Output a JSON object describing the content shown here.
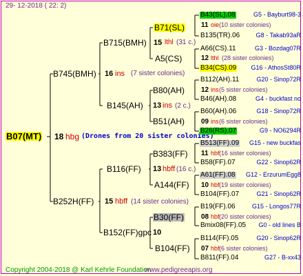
{
  "date": "29-  12-2018  (  22:   2)",
  "root": {
    "label": "B07(MT)",
    "num": "18",
    "tag": "hbg",
    "note": "(Drones from 20 sister colonies)"
  },
  "g1": [
    {
      "label": "B745(BMH)",
      "num": "16",
      "tag": "ins",
      "note": "(7 sister colonies)"
    },
    {
      "label": "B252H(FF)",
      "num": "15",
      "tag": "hbff",
      "note": "(14 sister colonies)"
    }
  ],
  "g2": [
    {
      "label": "B715(BMH)",
      "num": "",
      "tag": "",
      "note": ""
    },
    {
      "label": "B145(AH)",
      "num": "13",
      "tag": "ins",
      "note": "(2 c.)"
    },
    {
      "label": "B116(FF)",
      "num": "13",
      "tag": "hbff",
      "note": "(16 c.)"
    },
    {
      "label": "B152(FF)gpc",
      "num": "10",
      "tag": "",
      "note": ""
    }
  ],
  "g3": [
    {
      "label": "B71(SL)",
      "num": "15",
      "tag": "lthl",
      "note": "(31 c.)"
    },
    {
      "label": "A5(CS)",
      "num": "",
      "tag": "",
      "note": ""
    },
    {
      "label": "B80(AH)",
      "num": "",
      "tag": "",
      "note": ""
    },
    {
      "label": "B51(AH)",
      "num": "",
      "tag": "",
      "note": ""
    },
    {
      "label": "B383(FF)",
      "num": "",
      "tag": "",
      "note": ""
    },
    {
      "label": "A144(FF)",
      "num": "",
      "tag": "",
      "note": ""
    },
    {
      "label": "B30(FF)",
      "num": "",
      "tag": "",
      "note": ""
    },
    {
      "label": "B104(FF)",
      "num": "",
      "tag": "",
      "note": ""
    }
  ],
  "g4": [
    {
      "label": "B43(SL).08",
      "ref": "G5 - Bayburt98-3",
      "num": "11",
      "tag": "oie",
      "note": "(10 sister colonies)"
    },
    {
      "label": "B135(TR).06",
      "ref": "G8 - Takab93aR",
      "num": "",
      "tag": "",
      "note": ""
    },
    {
      "label": "A66(CS).11",
      "ref": "G3 - Bozdag07R",
      "num": "12",
      "tag": "lthl",
      "note": "(28 sister colonies)"
    },
    {
      "label": "B34(CS).09",
      "ref": "G16 - AthosSt80R",
      "num": "",
      "tag": "",
      "note": ""
    },
    {
      "label": "B112(AH).11",
      "ref": "G20 - Sinop72R",
      "num": "12",
      "tag": "ins",
      "note": "(5 sister colonies)"
    },
    {
      "label": "B46(AH).08",
      "ref": "G4 - buckfast no",
      "num": "",
      "tag": "",
      "note": ""
    },
    {
      "label": "B60(AH).06",
      "ref": "G18 - Sinop72R",
      "num": "09",
      "tag": "ins",
      "note": "(6 sister colonies)"
    },
    {
      "label": "B26(RS).07",
      "ref": "G9 - NO6294R",
      "num": "",
      "tag": "",
      "note": ""
    },
    {
      "label": "B513(FF).09",
      "ref": "G15 - new buckfas",
      "num": "11",
      "tag": "hbf",
      "note": "(16 sister colonies)"
    },
    {
      "label": "B58(FF).07",
      "ref": "G22 - Sinop62R",
      "num": "",
      "tag": "",
      "note": ""
    },
    {
      "label": "A61(FF).08",
      "ref": "G12 - ErzurumEgg8",
      "num": "10",
      "tag": "hbf",
      "note": "(19 sister colonies)"
    },
    {
      "label": "B104(FF).07",
      "ref": "G21 - Sinop62R",
      "num": "",
      "tag": "",
      "note": ""
    },
    {
      "label": "B19(FF).06",
      "ref": "G15 - Longos77R",
      "num": "08",
      "tag": "hbf",
      "note": "(20 sister colonies)"
    },
    {
      "label": "Bmix08(FF).05",
      "ref": "G0 - old lines B",
      "num": "",
      "tag": "",
      "note": ""
    },
    {
      "label": "B114(FF).05",
      "ref": "G20 - Sinop62R",
      "num": "07",
      "tag": "hbf",
      "note": "(6 sister colonies)"
    },
    {
      "label": "B811(FF).04",
      "ref": "G27 - B-xx43",
      "num": "",
      "tag": "",
      "note": ""
    }
  ],
  "footer": {
    "copyright": "Copyright 2004-2018 @ Karl Kehrle Foundation",
    "site": "www.pedigreeapis.org"
  }
}
